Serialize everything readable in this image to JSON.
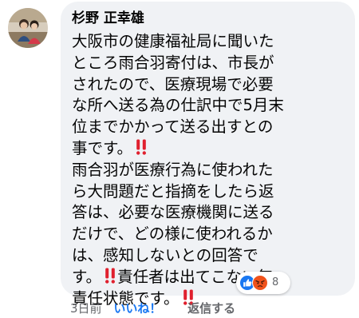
{
  "comment": {
    "author": "杉野 正幸雄",
    "lines": [
      {
        "text": "大阪市の健康福祉局に聞いた",
        "bang": false
      },
      {
        "text": "ところ雨合羽寄付は、市長が",
        "bang": false
      },
      {
        "text": "されたので、医療現場で必要",
        "bang": false
      },
      {
        "text": "な所へ送る為の仕訳中で5月末",
        "bang": false
      },
      {
        "text": "位までかかって送る出すとの",
        "bang": false
      },
      {
        "text": "事です。",
        "bang": true
      },
      {
        "text": "雨合羽が医療行為に使われた",
        "bang": false
      },
      {
        "text": "ら大問題だと指摘をしたら返",
        "bang": false
      },
      {
        "text": "答は、必要な医療機関に送る",
        "bang": false
      },
      {
        "text": "だけで、どの様に使われるか",
        "bang": false
      },
      {
        "text": "は、感知しないとの回答で",
        "bang": false
      },
      {
        "text": "す。",
        "bang": true,
        "after": "責任者は出てこない無"
      },
      {
        "text": "責任状態です。",
        "bang": true
      }
    ]
  },
  "reactions": {
    "icons": [
      "like-icon",
      "angry-icon"
    ],
    "count": "8",
    "colors": {
      "like": "#1877f2",
      "angry": "#f0521b"
    }
  },
  "footer": {
    "time": "3日前",
    "like": "いいね！",
    "reply": "返信する"
  },
  "colors": {
    "bubble": "#f0f2f5",
    "text": "#050505",
    "secondary": "#65676b",
    "link": "#1877f2",
    "bang": "#e0202e"
  }
}
